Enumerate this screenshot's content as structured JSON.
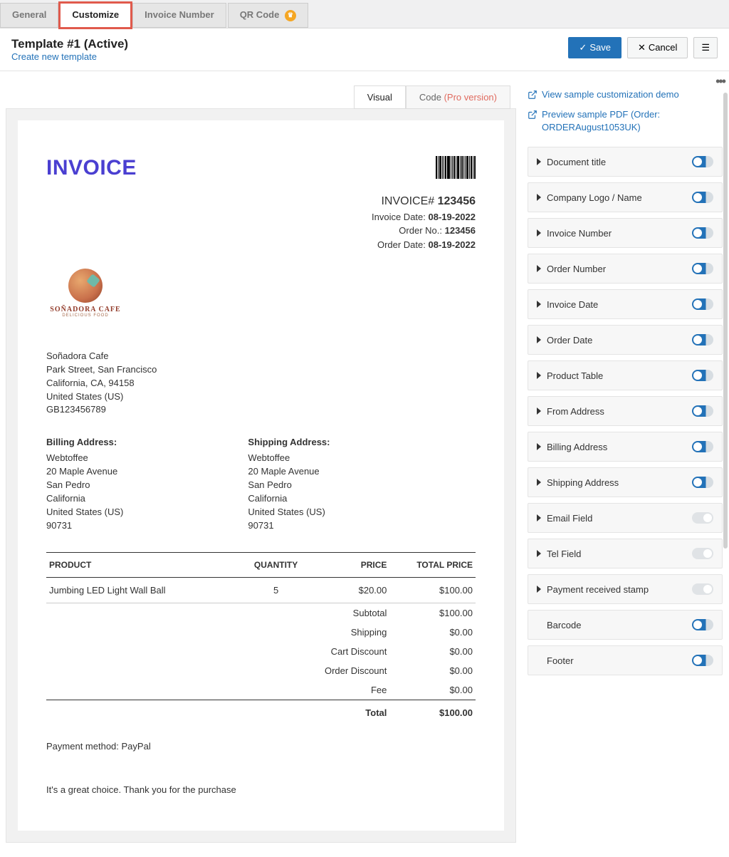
{
  "tabs": [
    {
      "label": "General"
    },
    {
      "label": "Customize"
    },
    {
      "label": "Invoice Number"
    },
    {
      "label": "QR Code"
    }
  ],
  "header": {
    "title": "Template #1 (Active)",
    "create_link": "Create new template",
    "save_label": "Save",
    "cancel_label": "Cancel"
  },
  "preview_tabs": {
    "visual": "Visual",
    "code": "Code",
    "pro": "(Pro version)"
  },
  "invoice": {
    "title": "INVOICE",
    "number_label": "INVOICE#",
    "number_value": "123456",
    "invoice_date_label": "Invoice Date:",
    "invoice_date_value": "08-19-2022",
    "order_no_label": "Order No.:",
    "order_no_value": "123456",
    "order_date_label": "Order Date:",
    "order_date_value": "08-19-2022",
    "logo_name": "SOÑADORA CAFE",
    "logo_tagline": "DELICIOUS FOOD",
    "from": {
      "name": "Soñadora Cafe",
      "line1": "Park Street, San Francisco",
      "line2": "California, CA, 94158",
      "country": "United States (US)",
      "vat": "GB123456789"
    },
    "billing_heading": "Billing Address:",
    "shipping_heading": "Shipping Address:",
    "billing": {
      "name": "Webtoffee",
      "line1": "20 Maple Avenue",
      "city": "San Pedro",
      "state": "California",
      "country": "United States (US)",
      "zip": "90731"
    },
    "shipping": {
      "name": "Webtoffee",
      "line1": "20 Maple Avenue",
      "city": "San Pedro",
      "state": "California",
      "country": "United States (US)",
      "zip": "90731"
    },
    "columns": {
      "product": "PRODUCT",
      "qty": "QUANTITY",
      "price": "PRICE",
      "total": "TOTAL PRICE"
    },
    "items": [
      {
        "name": "Jumbing LED Light Wall Ball",
        "qty": "5",
        "price": "$20.00",
        "total": "$100.00"
      }
    ],
    "summary": {
      "subtotal_label": "Subtotal",
      "subtotal_value": "$100.00",
      "shipping_label": "Shipping",
      "shipping_value": "$0.00",
      "cart_discount_label": "Cart Discount",
      "cart_discount_value": "$0.00",
      "order_discount_label": "Order Discount",
      "order_discount_value": "$0.00",
      "fee_label": "Fee",
      "fee_value": "$0.00",
      "total_label": "Total",
      "total_value": "$100.00"
    },
    "payment_method_label": "Payment method:",
    "payment_method_value": "PayPal",
    "footer_note": "It's a great choice. Thank you for the purchase"
  },
  "sidebar": {
    "demo_link": "View sample customization demo",
    "preview_link_prefix": "Preview sample PDF (Order: ",
    "preview_order": "ORDERAugust1053UK",
    "preview_link_suffix": ")",
    "panels": [
      {
        "label": "Document title",
        "on": true,
        "arrow": true
      },
      {
        "label": "Company Logo / Name",
        "on": true,
        "arrow": true
      },
      {
        "label": "Invoice Number",
        "on": true,
        "arrow": true
      },
      {
        "label": "Order Number",
        "on": true,
        "arrow": true
      },
      {
        "label": "Invoice Date",
        "on": true,
        "arrow": true
      },
      {
        "label": "Order Date",
        "on": true,
        "arrow": true
      },
      {
        "label": "Product Table",
        "on": true,
        "arrow": true
      },
      {
        "label": "From Address",
        "on": true,
        "arrow": true
      },
      {
        "label": "Billing Address",
        "on": true,
        "arrow": true
      },
      {
        "label": "Shipping Address",
        "on": true,
        "arrow": true
      },
      {
        "label": "Email Field",
        "on": false,
        "arrow": true
      },
      {
        "label": "Tel Field",
        "on": false,
        "arrow": true
      },
      {
        "label": "Payment received stamp",
        "on": false,
        "arrow": true
      },
      {
        "label": "Barcode",
        "on": true,
        "arrow": false
      },
      {
        "label": "Footer",
        "on": true,
        "arrow": false
      }
    ]
  }
}
